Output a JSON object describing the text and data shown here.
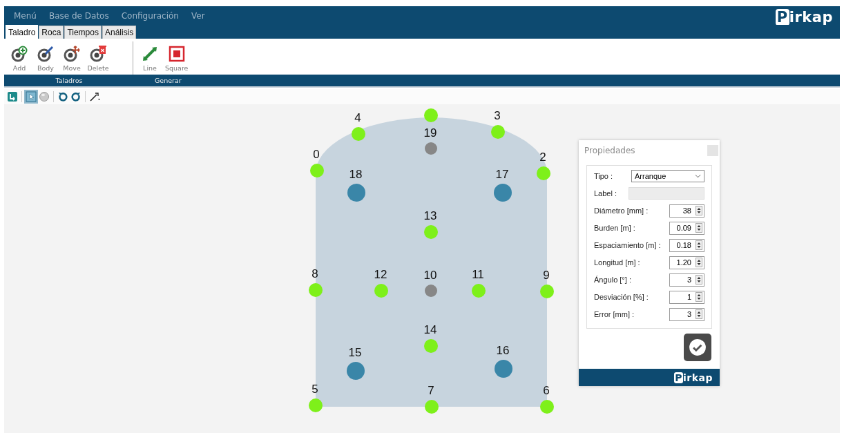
{
  "menu": [
    "Menú",
    "Base de Datos",
    "Configuración",
    "Ver"
  ],
  "logo": "Pirkap",
  "tabs": [
    {
      "label": "Taladro",
      "selected": true
    },
    {
      "label": "Roca",
      "selected": false
    },
    {
      "label": "Tiempos",
      "selected": false
    },
    {
      "label": "Análisis",
      "selected": false
    }
  ],
  "ribbon_groups": [
    {
      "label": "Taladros",
      "tools": [
        "Add",
        "Body",
        "Move",
        "Delete"
      ]
    },
    {
      "label": "Generar",
      "tools": [
        "Line",
        "Square"
      ]
    }
  ],
  "toolbar": [
    {
      "selected": false
    },
    {
      "selected": true
    },
    {
      "selected": false
    },
    {
      "selected": false
    },
    {
      "selected": false
    },
    {
      "selected": false
    }
  ],
  "holes": [
    {
      "label": "4",
      "kind": "contour"
    },
    {
      "kind": "contour"
    },
    {
      "label": "3",
      "kind": "contour"
    },
    {
      "label": "0",
      "kind": "contour"
    },
    {
      "label": "2",
      "kind": "contour"
    },
    {
      "label": "19",
      "kind": "empty"
    },
    {
      "label": "18",
      "kind": "cut"
    },
    {
      "label": "17",
      "kind": "cut"
    },
    {
      "label": "13",
      "kind": "contour"
    },
    {
      "label": "8",
      "kind": "contour"
    },
    {
      "label": "12",
      "kind": "contour"
    },
    {
      "label": "10",
      "kind": "empty"
    },
    {
      "label": "11",
      "kind": "contour"
    },
    {
      "label": "9",
      "kind": "contour"
    },
    {
      "label": "14",
      "kind": "contour"
    },
    {
      "label": "15",
      "kind": "cut"
    },
    {
      "label": "16",
      "kind": "cut"
    },
    {
      "label": "5",
      "kind": "contour"
    },
    {
      "label": "7",
      "kind": "contour"
    },
    {
      "label": "6",
      "kind": "contour"
    }
  ],
  "properties": {
    "title": "Propiedades",
    "logo": "Pirkap",
    "fields": [
      {
        "label": "Tipo :",
        "kind": "select",
        "value": "Arranque",
        "disabled": false
      },
      {
        "label": "Label :",
        "kind": "text",
        "disabled": true
      },
      {
        "label": "Diámetro [mm] :",
        "kind": "spin",
        "value": "38",
        "disabled": false
      },
      {
        "label": "Burden [m] :",
        "kind": "spin",
        "value": "0.09",
        "disabled": false
      },
      {
        "label": "Espaciamiento [m] :",
        "kind": "spin",
        "value": "0.18",
        "disabled": false
      },
      {
        "label": "Longitud [m] :",
        "kind": "spin",
        "value": "1.20",
        "disabled": false
      },
      {
        "label": "Ángulo [°] :",
        "kind": "spin",
        "value": "3",
        "disabled": false
      },
      {
        "label": "Desviación [%] :",
        "kind": "spin",
        "value": "1",
        "disabled": false
      },
      {
        "label": "Error [mm] :",
        "kind": "spin",
        "value": "3",
        "disabled": false
      }
    ]
  }
}
